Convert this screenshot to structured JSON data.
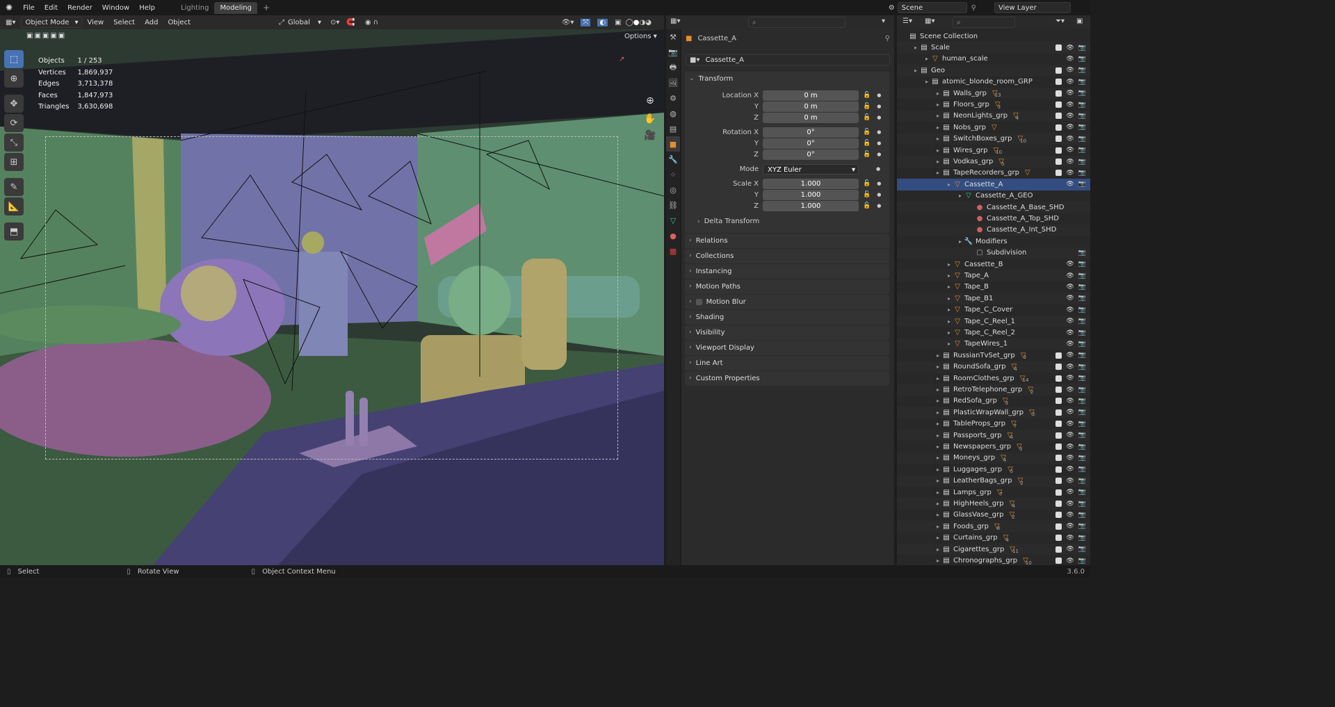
{
  "topbar": {
    "menus": [
      "File",
      "Edit",
      "Render",
      "Window",
      "Help"
    ],
    "workspaces": [
      "Lighting",
      "Modeling"
    ],
    "scene": "Scene",
    "view_layer": "View Layer"
  },
  "viewport_header": {
    "mode": "Object Mode",
    "menus": [
      "View",
      "Select",
      "Add",
      "Object"
    ],
    "orientation": "Global",
    "options": "Options"
  },
  "stats": [
    {
      "label": "Objects",
      "value": "1 / 253"
    },
    {
      "label": "Vertices",
      "value": "1,869,937"
    },
    {
      "label": "Edges",
      "value": "3,713,378"
    },
    {
      "label": "Faces",
      "value": "1,847,973"
    },
    {
      "label": "Triangles",
      "value": "3,630,698"
    }
  ],
  "properties": {
    "object_name": "Cassette_A",
    "data_name": "Cassette_A",
    "transform_title": "Transform",
    "location": [
      {
        "label": "Location X",
        "value": "0 m"
      },
      {
        "label": "Y",
        "value": "0 m"
      },
      {
        "label": "Z",
        "value": "0 m"
      }
    ],
    "rotation": [
      {
        "label": "Rotation X",
        "value": "0°"
      },
      {
        "label": "Y",
        "value": "0°"
      },
      {
        "label": "Z",
        "value": "0°"
      }
    ],
    "mode_label": "Mode",
    "mode_value": "XYZ Euler",
    "scale": [
      {
        "label": "Scale X",
        "value": "1.000"
      },
      {
        "label": "Y",
        "value": "1.000"
      },
      {
        "label": "Z",
        "value": "1.000"
      }
    ],
    "delta": "Delta Transform",
    "sections": [
      "Relations",
      "Collections",
      "Instancing",
      "Motion Paths",
      "Motion Blur",
      "Shading",
      "Visibility",
      "Viewport Display",
      "Line Art",
      "Custom Properties"
    ]
  },
  "outliner": {
    "rows": [
      {
        "depth": 0,
        "name": "Scene Collection",
        "icon": "collection-icon"
      },
      {
        "depth": 1,
        "name": "Scale",
        "icon": "collection-icon"
      },
      {
        "depth": 2,
        "name": "human_scale",
        "icon": "object-icon"
      },
      {
        "depth": 1,
        "name": "Geo",
        "icon": "collection-icon"
      },
      {
        "depth": 2,
        "name": "atomic_blonde_room_GRP",
        "icon": "collection-icon"
      },
      {
        "depth": 3,
        "name": "Walls_grp",
        "icon": "collection-icon",
        "sub": "13"
      },
      {
        "depth": 3,
        "name": "Floors_grp",
        "icon": "collection-icon",
        "sub": "3"
      },
      {
        "depth": 3,
        "name": "NeonLights_grp",
        "icon": "collection-icon",
        "sub": "4"
      },
      {
        "depth": 3,
        "name": "Nobs_grp",
        "icon": "collection-icon"
      },
      {
        "depth": 3,
        "name": "SwitchBoxes_grp",
        "icon": "collection-icon",
        "sub": "10"
      },
      {
        "depth": 3,
        "name": "Wires_grp",
        "icon": "collection-icon",
        "sub": "10"
      },
      {
        "depth": 3,
        "name": "Vodkas_grp",
        "icon": "collection-icon",
        "sub": "5"
      },
      {
        "depth": 3,
        "name": "TapeRecorders_grp",
        "icon": "collection-icon"
      },
      {
        "depth": 4,
        "name": "Cassette_A",
        "icon": "object-icon",
        "selected": true
      },
      {
        "depth": 5,
        "name": "Cassette_A_GEO",
        "icon": "mesh-icon"
      },
      {
        "depth": 6,
        "name": "Cassette_A_Base_SHD",
        "icon": "material-icon"
      },
      {
        "depth": 6,
        "name": "Cassette_A_Top_SHD",
        "icon": "material-icon"
      },
      {
        "depth": 6,
        "name": "Cassette_A_Int_SHD",
        "icon": "material-icon"
      },
      {
        "depth": 5,
        "name": "Modifiers",
        "icon": "wrench-icon"
      },
      {
        "depth": 6,
        "name": "Subdivision",
        "icon": "modifier-icon"
      },
      {
        "depth": 4,
        "name": "Cassette_B",
        "icon": "object-icon"
      },
      {
        "depth": 4,
        "name": "Tape_A",
        "icon": "object-icon"
      },
      {
        "depth": 4,
        "name": "Tape_B",
        "icon": "object-icon"
      },
      {
        "depth": 4,
        "name": "Tape_B1",
        "icon": "object-icon"
      },
      {
        "depth": 4,
        "name": "Tape_C_Cover",
        "icon": "object-icon"
      },
      {
        "depth": 4,
        "name": "Tape_C_Reel_1",
        "icon": "object-icon"
      },
      {
        "depth": 4,
        "name": "Tape_C_Reel_2",
        "icon": "object-icon"
      },
      {
        "depth": 4,
        "name": "TapeWires_1",
        "icon": "object-icon"
      },
      {
        "depth": 3,
        "name": "RussianTvSet_grp",
        "icon": "collection-icon",
        "sub": "3"
      },
      {
        "depth": 3,
        "name": "RoundSofa_grp",
        "icon": "collection-icon",
        "sub": "4"
      },
      {
        "depth": 3,
        "name": "RoomClothes_grp",
        "icon": "collection-icon",
        "sub": "14"
      },
      {
        "depth": 3,
        "name": "RetroTelephone_grp",
        "icon": "collection-icon",
        "sub": "2"
      },
      {
        "depth": 3,
        "name": "RedSofa_grp",
        "icon": "collection-icon",
        "sub": "3"
      },
      {
        "depth": 3,
        "name": "PlasticWrapWall_grp",
        "icon": "collection-icon",
        "sub": "3"
      },
      {
        "depth": 3,
        "name": "TableProps_grp",
        "icon": "collection-icon",
        "sub": "7"
      },
      {
        "depth": 3,
        "name": "Passports_grp",
        "icon": "collection-icon",
        "sub": "4"
      },
      {
        "depth": 3,
        "name": "Newspapers_grp",
        "icon": "collection-icon",
        "sub": "3"
      },
      {
        "depth": 3,
        "name": "Moneys_grp",
        "icon": "collection-icon",
        "sub": "4"
      },
      {
        "depth": 3,
        "name": "Luggages_grp",
        "icon": "collection-icon",
        "sub": "5"
      },
      {
        "depth": 3,
        "name": "LeatherBags_grp",
        "icon": "collection-icon",
        "sub": "2"
      },
      {
        "depth": 3,
        "name": "Lamps_grp",
        "icon": "collection-icon",
        "sub": "7"
      },
      {
        "depth": 3,
        "name": "HighHeels_grp",
        "icon": "collection-icon",
        "sub": "4"
      },
      {
        "depth": 3,
        "name": "GlassVase_grp",
        "icon": "collection-icon",
        "sub": "2"
      },
      {
        "depth": 3,
        "name": "Foods_grp",
        "icon": "collection-icon",
        "sub": "8"
      },
      {
        "depth": 3,
        "name": "Curtains_grp",
        "icon": "collection-icon",
        "sub": "4"
      },
      {
        "depth": 3,
        "name": "Cigarettes_grp",
        "icon": "collection-icon",
        "sub": "11"
      },
      {
        "depth": 3,
        "name": "Chronographs_grp",
        "icon": "collection-icon",
        "sub": "10"
      }
    ]
  },
  "statusbar": {
    "select": "Select",
    "rotate": "Rotate View",
    "context": "Object Context Menu",
    "version": "3.6.0"
  },
  "colors": {
    "accent": "#4772b3",
    "object_orange": "#e38f2e",
    "mesh_green": "#38c19a"
  }
}
